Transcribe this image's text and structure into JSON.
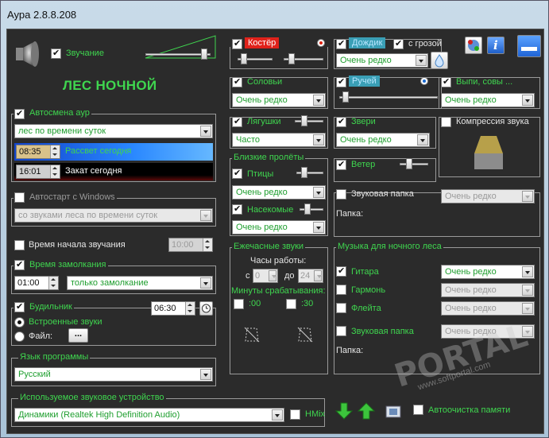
{
  "window": {
    "title": "Аура 2.8.8.208"
  },
  "header": {
    "sound_label": "Звучание",
    "scene_name": "ЛЕС НОЧНОЙ"
  },
  "auto_change": {
    "title": "Автосмена аур",
    "mode": "лес по времени суток",
    "sunrise_time": "08:35",
    "sunrise_label": "Рассвет сегодня",
    "sunset_time": "16:01",
    "sunset_label": "Закат сегодня"
  },
  "autostart": {
    "title": "Автостарт с Windows",
    "mode": "со звуками леса по времени суток"
  },
  "start_time": {
    "label": "Время начала звучания",
    "value": "10:00"
  },
  "fade_time": {
    "title": "Время замолкания",
    "value": "01:00",
    "mode": "только замолкание"
  },
  "alarm": {
    "title": "Будильник",
    "time": "06:30",
    "builtin_label": "Встроенные звуки",
    "file_label": "Файл:",
    "file_button": "..."
  },
  "language": {
    "title": "Язык программы",
    "value": "Русский"
  },
  "device": {
    "title": "Используемое звуковое устройство",
    "value": "Динамики (Realtek High Definition Audio)",
    "hmix_label": "HMix"
  },
  "mid": {
    "campfire_label": "Костёр",
    "nightingales_label": "Соловьи",
    "nightingales_freq": "Очень редко",
    "frogs_label": "Лягушки",
    "frogs_freq": "Часто",
    "flyby_title": "Близкие пролёты",
    "birds_label": "Птицы",
    "birds_freq": "Очень редко",
    "insects_label": "Насекомые",
    "insects_freq": "Очень редко",
    "hedgehog_title": "Ежечасные звуки",
    "work_hours_label": "Часы работы:",
    "from_label": "с",
    "from_value": "0",
    "to_label": "до",
    "to_value": "24",
    "trigger_minutes_label": "Минуты срабатывания:",
    "min00_label": ":00",
    "min30_label": ":30"
  },
  "right": {
    "rain_label": "Дождик",
    "storm_label": "с грозой",
    "rain_freq": "Очень редко",
    "stream_label": "Ручей",
    "owls_label": "Выпи, совы ...",
    "owls_freq": "Очень редко",
    "beasts_label": "Звери",
    "beasts_freq": "Очень редко",
    "compress_label": "Компрессия звука",
    "wind_label": "Ветер",
    "sound_folder_label": "Звуковая папка",
    "sound_folder_freq": "Очень редко",
    "folder_label": "Папка:",
    "music_title": "Музыка для ночного леса",
    "guitar_label": "Гитара",
    "guitar_freq": "Очень редко",
    "harmonica_label": "Гармонь",
    "harmonica_freq": "Очень редко",
    "flute_label": "Флейта",
    "flute_freq": "Очень редко",
    "music_folder_label": "Звуковая папка",
    "music_folder_freq": "Очень редко",
    "music_folder_path_label": "Папка:",
    "autoclean_label": "Автоочистка памяти"
  },
  "watermark": {
    "brand": "PORTAL",
    "url": "www.softportal.com"
  },
  "colors": {
    "accent_green": "#3fd64f",
    "panel": "#2b2b2b",
    "tag_red": "#e0221b",
    "tag_blue": "#3a9fb6"
  }
}
